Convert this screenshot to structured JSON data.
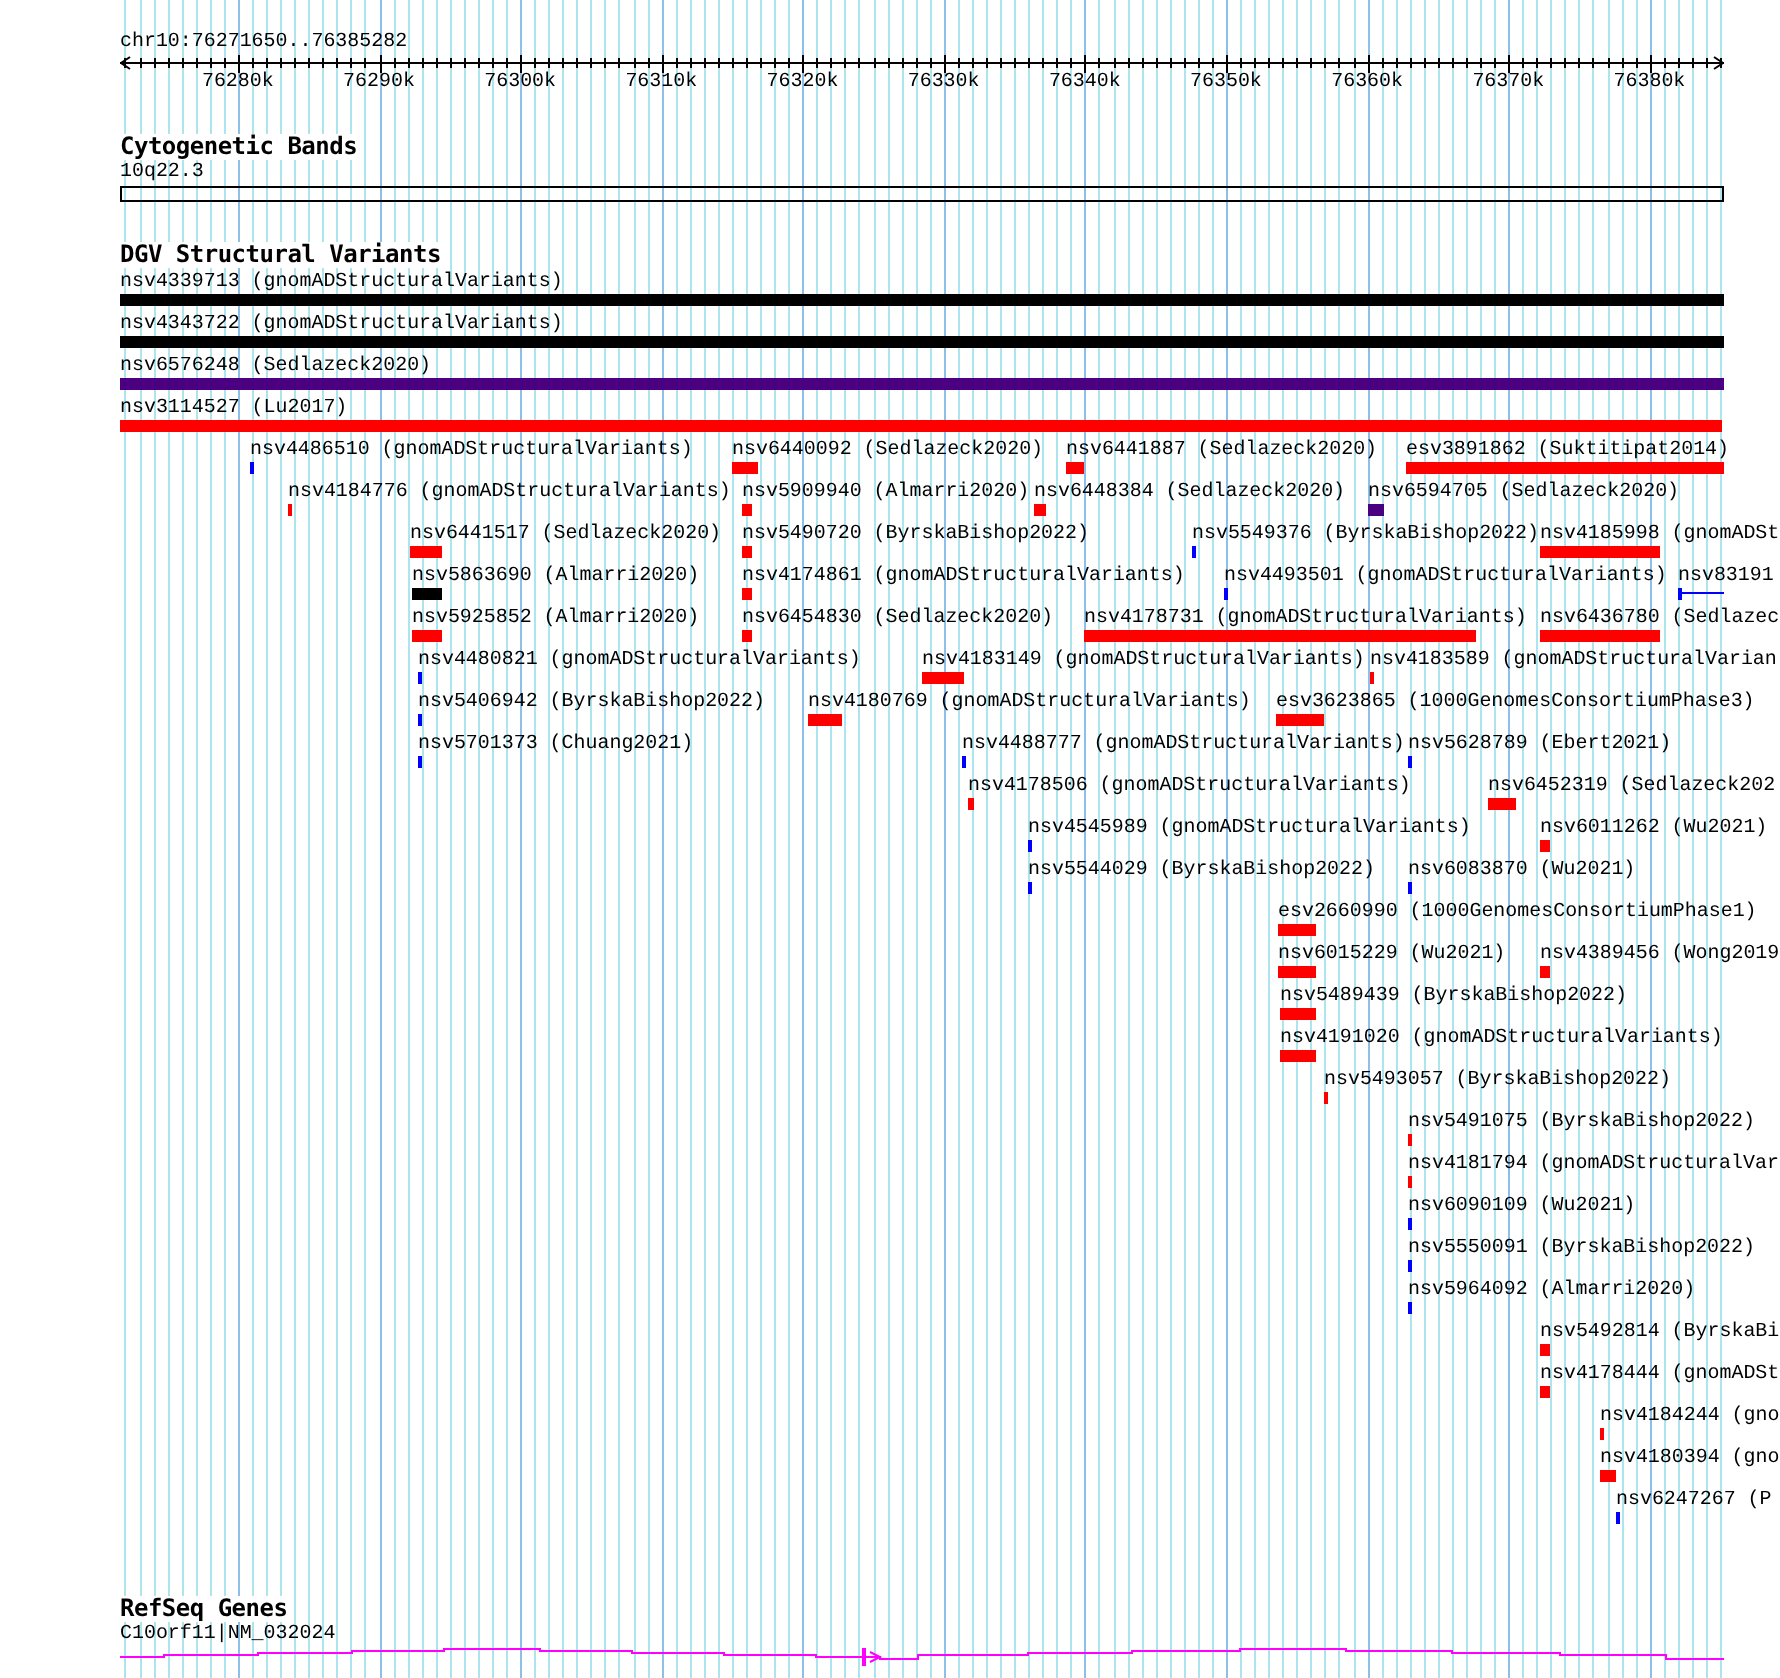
{
  "location": "chr10:76271650..76385282",
  "ruler": {
    "ticks": [
      "76280k",
      "76290k",
      "76300k",
      "76310k",
      "76320k",
      "76330k",
      "76340k",
      "76350k",
      "76360k",
      "76370k",
      "76380k"
    ]
  },
  "tracks": [
    {
      "kind": "cytoband",
      "title": "Cytogenetic Bands",
      "label": "10q22.3"
    },
    {
      "kind": "variants",
      "title": "DGV Structural Variants",
      "rows": [
        [
          {
            "label": "nsv4339713 (gnomADStructuralVariants)",
            "color": "#000000",
            "kind": "bar"
          }
        ],
        [
          {
            "label": "nsv4343722 (gnomADStructuralVariants)",
            "color": "#000000",
            "kind": "bar"
          }
        ],
        [
          {
            "label": "nsv6576248 (Sedlazeck2020)",
            "color": "#4b0082",
            "kind": "bar"
          }
        ],
        [
          {
            "label": "nsv3114527 (Lu2017)",
            "color": "#ff0000",
            "kind": "bar"
          }
        ],
        [
          {
            "label": "nsv4486510 (gnomADStructuralVariants)",
            "color": "#0000ff",
            "kind": "bar"
          },
          {
            "label": "nsv6440092 (Sedlazeck2020)",
            "color": "#ff0000",
            "kind": "bar"
          },
          {
            "label": "nsv6441887 (Sedlazeck2020)",
            "color": "#ff0000",
            "kind": "bar"
          },
          {
            "label": "esv3891862 (Suktitipat2014)",
            "color": "#ff0000",
            "kind": "bar"
          }
        ],
        [
          {
            "label": "nsv4184776 (gnomADStructuralVariants)",
            "color": "#ff0000",
            "kind": "bar"
          },
          {
            "label": "nsv5909940 (Almarri2020)",
            "color": "#ff0000",
            "kind": "bar"
          },
          {
            "label": "nsv6448384 (Sedlazeck2020)",
            "color": "#ff0000",
            "kind": "bar"
          },
          {
            "label": "nsv6594705 (Sedlazeck2020)",
            "color": "#4b0082",
            "kind": "bar"
          }
        ],
        [
          {
            "label": "nsv6441517 (Sedlazeck2020)",
            "color": "#ff0000",
            "kind": "bar"
          },
          {
            "label": "nsv5490720 (ByrskaBishop2022)",
            "color": "#ff0000",
            "kind": "bar"
          },
          {
            "label": "nsv5549376 (ByrskaBishop2022)",
            "color": "#0000ff",
            "kind": "bar"
          },
          {
            "label": "nsv4185998 (gnomADSt",
            "color": "#ff0000",
            "kind": "bar"
          }
        ],
        [
          {
            "label": "nsv5863690 (Almarri2020)",
            "color": "#000000",
            "kind": "bar"
          },
          {
            "label": "nsv4174861 (gnomADStructuralVariants)",
            "color": "#ff0000",
            "kind": "bar"
          },
          {
            "label": "nsv4493501 (gnomADStructuralVariants)",
            "color": "#0000ff",
            "kind": "bar"
          },
          {
            "label": "nsv83191",
            "color": "#0000ff",
            "kind": "line"
          }
        ],
        [
          {
            "label": "nsv5925852 (Almarri2020)",
            "color": "#ff0000",
            "kind": "bar"
          },
          {
            "label": "nsv6454830 (Sedlazeck2020)",
            "color": "#ff0000",
            "kind": "bar"
          },
          {
            "label": "nsv4178731 (gnomADStructuralVariants)",
            "color": "#ff0000",
            "kind": "bar"
          },
          {
            "label": "nsv6436780 (Sedlazec",
            "color": "#ff0000",
            "kind": "bar"
          }
        ],
        [
          {
            "label": "nsv4480821 (gnomADStructuralVariants)",
            "color": "#0000ff",
            "kind": "bar"
          },
          {
            "label": "nsv4183149 (gnomADStructuralVariants)",
            "color": "#ff0000",
            "kind": "bar"
          },
          {
            "label": "nsv4183589 (gnomADStructuralVarian",
            "color": "#ff0000",
            "kind": "bar"
          }
        ],
        [
          {
            "label": "nsv5406942 (ByrskaBishop2022)",
            "color": "#0000ff",
            "kind": "bar"
          },
          {
            "label": "nsv4180769 (gnomADStructuralVariants)",
            "color": "#ff0000",
            "kind": "bar"
          },
          {
            "label": "esv3623865 (1000GenomesConsortiumPhase3)",
            "color": "#ff0000",
            "kind": "bar"
          }
        ],
        [
          {
            "label": "nsv5701373 (Chuang2021)",
            "color": "#0000ff",
            "kind": "bar"
          },
          {
            "label": "nsv4488777 (gnomADStructuralVariants)",
            "color": "#0000ff",
            "kind": "bar"
          },
          {
            "label": "nsv5628789 (Ebert2021)",
            "color": "#0000ff",
            "kind": "bar"
          }
        ],
        [
          {
            "label": "nsv4178506 (gnomADStructuralVariants)",
            "color": "#ff0000",
            "kind": "bar"
          },
          {
            "label": "nsv6452319 (Sedlazeck202",
            "color": "#ff0000",
            "kind": "bar"
          }
        ],
        [
          {
            "label": "nsv4545989 (gnomADStructuralVariants)",
            "color": "#0000ff",
            "kind": "bar"
          },
          {
            "label": "nsv6011262 (Wu2021)",
            "color": "#ff0000",
            "kind": "bar"
          }
        ],
        [
          {
            "label": "nsv5544029 (ByrskaBishop2022)",
            "color": "#0000ff",
            "kind": "bar"
          },
          {
            "label": "nsv6083870 (Wu2021)",
            "color": "#0000ff",
            "kind": "bar"
          }
        ],
        [
          {
            "label": "esv2660990 (1000GenomesConsortiumPhase1)",
            "color": "#ff0000",
            "kind": "bar"
          }
        ],
        [
          {
            "label": "nsv6015229 (Wu2021)",
            "color": "#ff0000",
            "kind": "bar"
          },
          {
            "label": "nsv4389456 (Wong2019",
            "color": "#ff0000",
            "kind": "bar"
          }
        ],
        [
          {
            "label": "nsv5489439 (ByrskaBishop2022)",
            "color": "#ff0000",
            "kind": "bar"
          }
        ],
        [
          {
            "label": "nsv4191020 (gnomADStructuralVariants)",
            "color": "#ff0000",
            "kind": "bar"
          }
        ],
        [
          {
            "label": "nsv5493057 (ByrskaBishop2022)",
            "color": "#ff0000",
            "kind": "bar"
          }
        ],
        [
          {
            "label": "nsv5491075 (ByrskaBishop2022)",
            "color": "#ff0000",
            "kind": "bar"
          }
        ],
        [
          {
            "label": "nsv4181794 (gnomADStructuralVar",
            "color": "#ff0000",
            "kind": "bar"
          }
        ],
        [
          {
            "label": "nsv6090109 (Wu2021)",
            "color": "#0000ff",
            "kind": "bar"
          }
        ],
        [
          {
            "label": "nsv5550091 (ByrskaBishop2022)",
            "color": "#0000ff",
            "kind": "bar"
          }
        ],
        [
          {
            "label": "nsv5964092 (Almarri2020)",
            "color": "#0000ff",
            "kind": "bar"
          }
        ],
        [
          {
            "label": "nsv5492814 (ByrskaBi",
            "color": "#ff0000",
            "kind": "bar"
          }
        ],
        [
          {
            "label": "nsv4178444 (gnomADSt",
            "color": "#ff0000",
            "kind": "bar"
          }
        ],
        [
          {
            "label": "nsv4184244 (gno",
            "color": "#ff0000",
            "kind": "bar"
          }
        ],
        [
          {
            "label": "nsv4180394 (gno",
            "color": "#ff0000",
            "kind": "bar"
          }
        ],
        [
          {
            "label": "nsv6247267 (P",
            "color": "#0000ff",
            "kind": "bar"
          }
        ]
      ]
    },
    {
      "kind": "gene",
      "title": "RefSeq Genes",
      "label": "C10orf11|NM_032024"
    }
  ]
}
